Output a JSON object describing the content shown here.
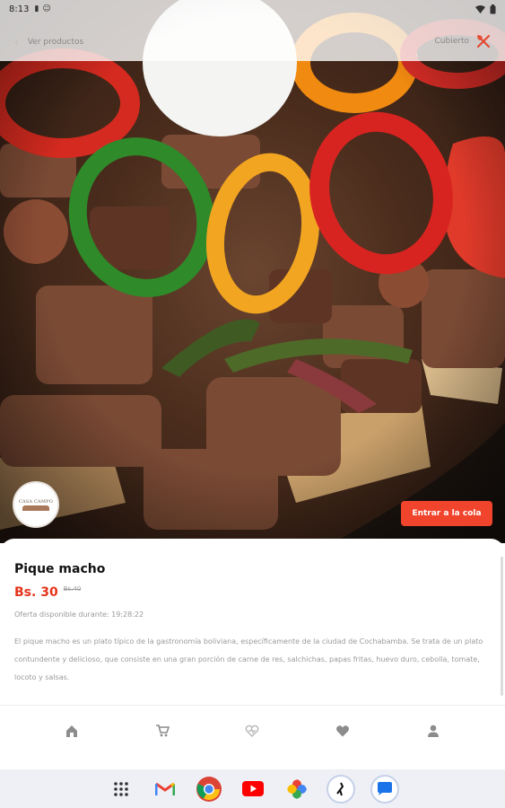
{
  "status_bar": {
    "time": "8:13",
    "icons_left": [
      "sd-card-icon",
      "face-icon"
    ],
    "icons_right": [
      "wifi-icon",
      "battery-icon"
    ]
  },
  "top_bar": {
    "back_label": "Ver productos",
    "cubierto_label": "Cubierto"
  },
  "restaurant": {
    "logo_text": "CASA CAMPO"
  },
  "actions": {
    "enter_queue_label": "Entrar a la cola"
  },
  "product": {
    "name": "Pique macho",
    "price": "Bs. 30",
    "old_price": "Bs.40",
    "offer_text": "Oferta disponible durante: 19:28:22",
    "description": "El pique macho es un plato típico de la gastronomía boliviana, específicamente de la ciudad de Cochabamba. Se trata de un plato contundente y delicioso, que consiste en una gran porción de carne de res, salchichas, papas fritas, huevo duro, cebolla, tomate, locoto y salsas."
  },
  "bottom_nav": [
    "home-icon",
    "cart-icon",
    "health-icon",
    "favorites-icon",
    "profile-icon"
  ],
  "taskbar_apps": [
    "app-drawer",
    "gmail",
    "chrome",
    "youtube",
    "photos",
    "app-circle",
    "messages"
  ],
  "colors": {
    "accent": "#f0442c",
    "price": "#e5341c"
  }
}
